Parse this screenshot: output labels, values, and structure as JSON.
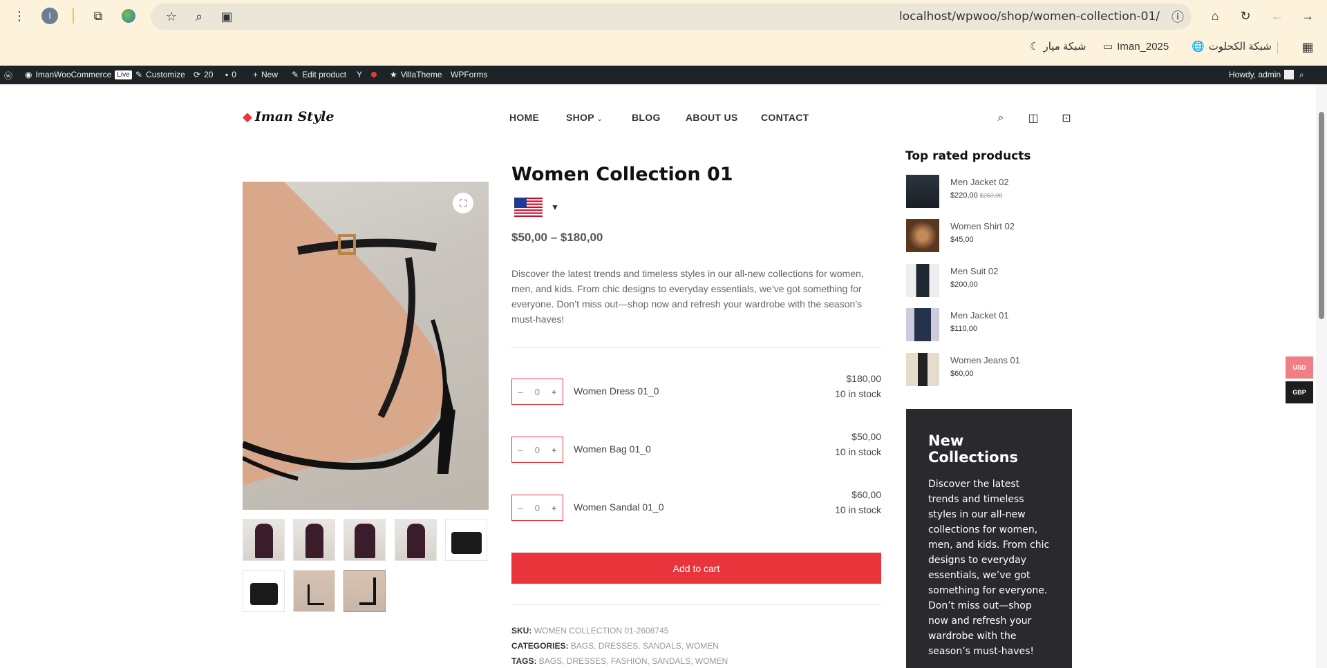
{
  "browser": {
    "url": "localhost/wpwoo/shop/women-collection-01/",
    "profile_initial": "I",
    "bookmarks": [
      "شبكة الكحلوت",
      "Iman_2025",
      "شبكة ميار"
    ]
  },
  "adminbar": {
    "site": "ImanWooCommerce",
    "live": "Live",
    "customize": "Customize",
    "updates": "20",
    "comments": "0",
    "new": "New",
    "edit": "Edit product",
    "villa": "VillaTheme",
    "wpforms": "WPForms",
    "howdy": "Howdy, admin"
  },
  "header": {
    "logo": "Iman Style",
    "nav": [
      "HOME",
      "SHOP",
      "BLOG",
      "ABOUT US",
      "CONTACT"
    ]
  },
  "product": {
    "title": "Women Collection 01",
    "price": "$50,00 – $180,00",
    "description": "Discover the latest trends and timeless styles in our all-new collections for women, men, and kids. From chic designs to everyday essentials, we’ve got something for everyone. Don’t miss out—shop now and refresh your wardrobe with the season’s must-haves!",
    "items": [
      {
        "name": "Women Dress 01_0",
        "price": "$180,00",
        "stock": "10 in stock",
        "qty": "0"
      },
      {
        "name": "Women Bag 01_0",
        "price": "$50,00",
        "stock": "10 in stock",
        "qty": "0"
      },
      {
        "name": "Women Sandal 01_0",
        "price": "$60,00",
        "stock": "10 in stock",
        "qty": "0"
      }
    ],
    "add_to_cart": "Add to cart",
    "sku_label": "SKU:",
    "sku": "WOMEN COLLECTION 01-2608745",
    "categories_label": "CATEGORIES:",
    "categories": "BAGS, DRESSES, SANDALS, WOMEN",
    "tags_label": "TAGS:",
    "tags": "BAGS, DRESSES, FASHION, SANDALS, WOMEN"
  },
  "sidebar": {
    "top_rated_title": "Top rated products",
    "products": [
      {
        "name": "Men Jacket 02",
        "price": "$220,00",
        "old": "$250,00"
      },
      {
        "name": "Women Shirt 02",
        "price": "$45,00",
        "old": ""
      },
      {
        "name": "Men Suit 02",
        "price": "$200,00",
        "old": ""
      },
      {
        "name": "Men Jacket 01",
        "price": "$110,00",
        "old": ""
      },
      {
        "name": "Women Jeans 01",
        "price": "$60,00",
        "old": ""
      }
    ],
    "promo_title": "New Collections",
    "promo_text": "Discover the latest trends and timeless styles in our all-new collections for women, men, and kids. From chic designs to everyday essentials, we’ve got something for everyone. Don’t miss out—shop now and refresh your wardrobe with the season’s must-haves!"
  },
  "currency": [
    "USD",
    "GBP"
  ],
  "colors": {
    "accent": "#e8343a",
    "adminbar": "#1d2327",
    "promo": "#2a2a2e"
  }
}
